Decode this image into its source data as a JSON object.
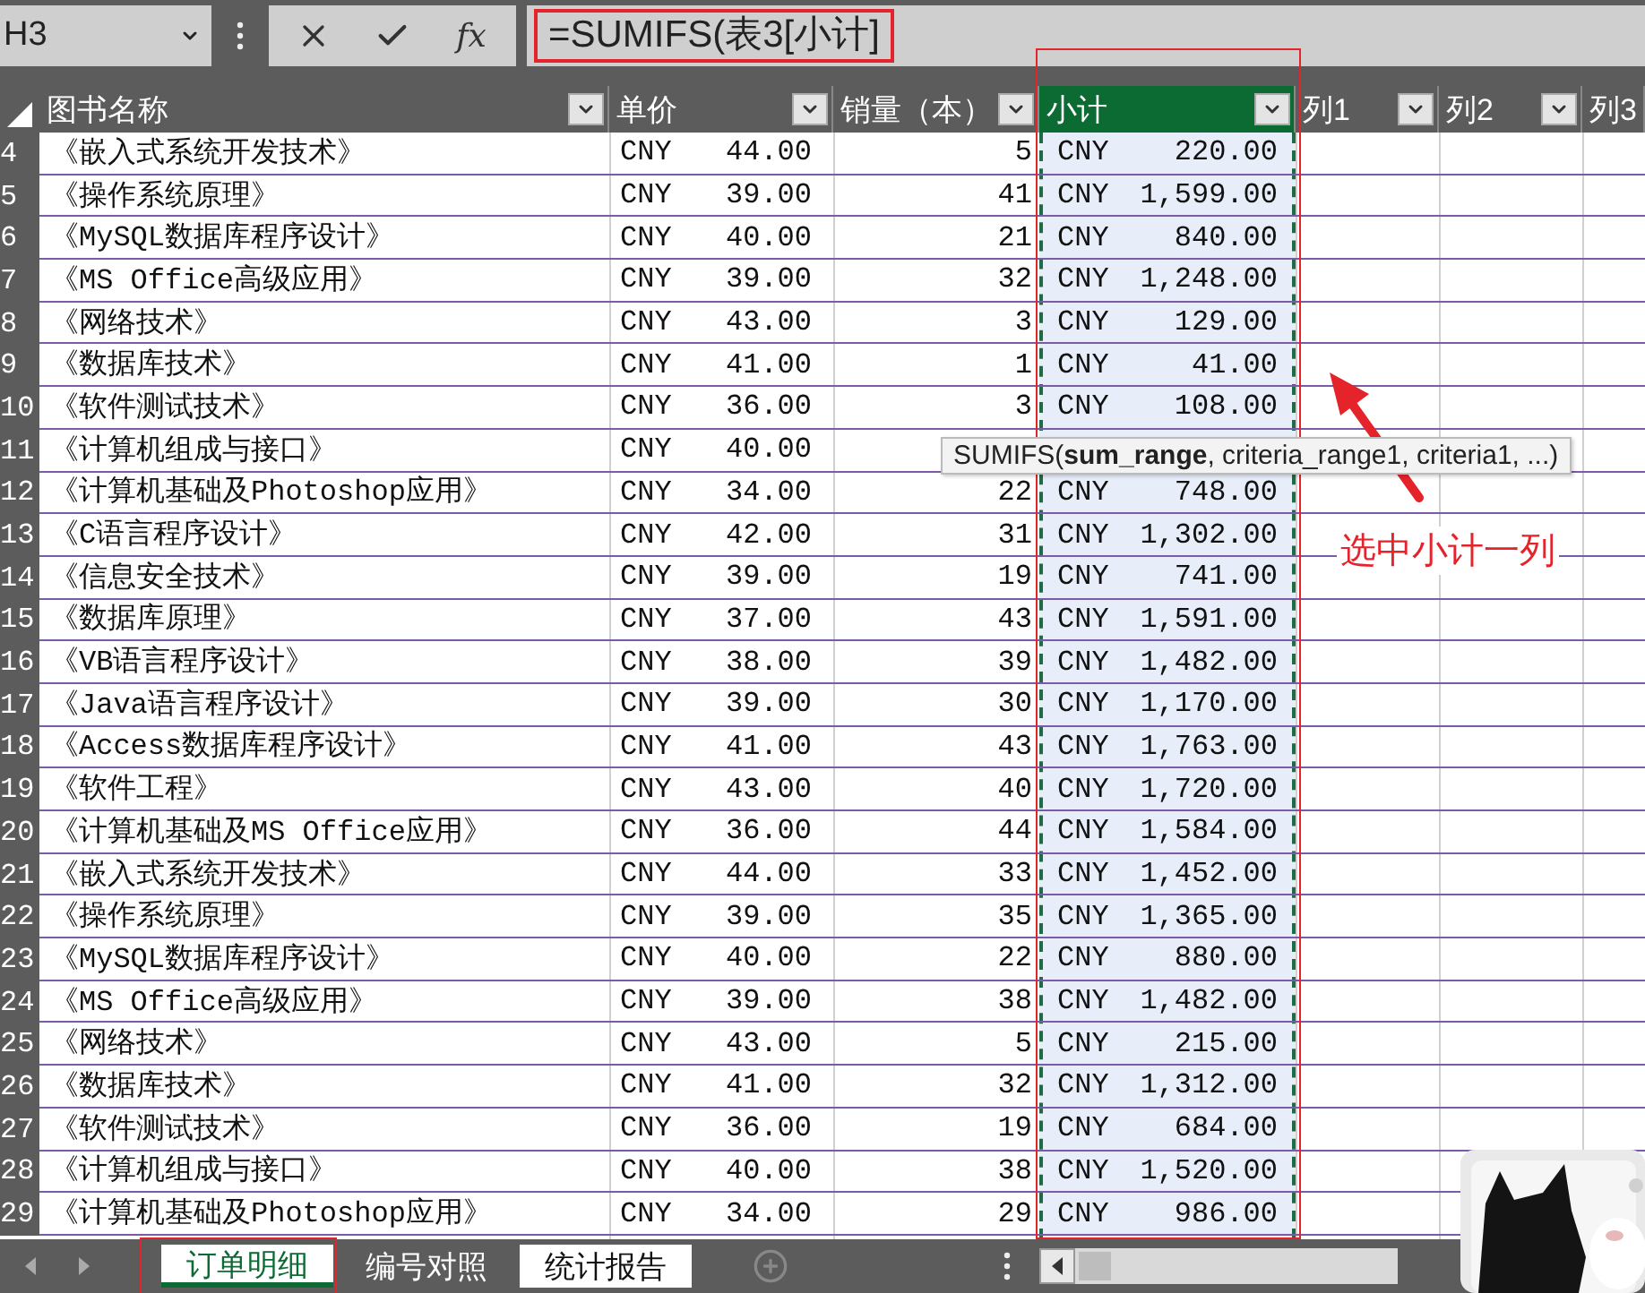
{
  "name_box": {
    "value": "H3"
  },
  "formula_bar": {
    "buttons": [
      {
        "kind": "cancel"
      },
      {
        "kind": "enter"
      },
      {
        "kind": "function",
        "label": "fx"
      }
    ],
    "formula": "=SUMIFS(表3[小计]"
  },
  "columns": [
    {
      "label": "图书名称",
      "selected": false,
      "filter": true
    },
    {
      "label": "单价",
      "selected": false,
      "filter": true
    },
    {
      "label": "销量（本）",
      "selected": false,
      "filter": true
    },
    {
      "label": "小计",
      "selected": true,
      "filter": true
    },
    {
      "label": "列1",
      "selected": false,
      "filter": true
    },
    {
      "label": "列2",
      "selected": false,
      "filter": true
    },
    {
      "label": "列3",
      "selected": false,
      "filter": false
    }
  ],
  "rows": [
    {
      "row": "4",
      "title": "《嵌入式系统开发技术》",
      "price": {
        "currency": "CNY",
        "amount": "44.00"
      },
      "quantity": "5",
      "subtotal": {
        "currency": "CNY",
        "amount": "220.00"
      }
    },
    {
      "row": "5",
      "title": "《操作系统原理》",
      "price": {
        "currency": "CNY",
        "amount": "39.00"
      },
      "quantity": "41",
      "subtotal": {
        "currency": "CNY",
        "amount": "1,599.00"
      }
    },
    {
      "row": "6",
      "title": "《MySQL数据库程序设计》",
      "price": {
        "currency": "CNY",
        "amount": "40.00"
      },
      "quantity": "21",
      "subtotal": {
        "currency": "CNY",
        "amount": "840.00"
      }
    },
    {
      "row": "7",
      "title": "《MS Office高级应用》",
      "price": {
        "currency": "CNY",
        "amount": "39.00"
      },
      "quantity": "32",
      "subtotal": {
        "currency": "CNY",
        "amount": "1,248.00"
      }
    },
    {
      "row": "8",
      "title": "《网络技术》",
      "price": {
        "currency": "CNY",
        "amount": "43.00"
      },
      "quantity": "3",
      "subtotal": {
        "currency": "CNY",
        "amount": "129.00"
      }
    },
    {
      "row": "9",
      "title": "《数据库技术》",
      "price": {
        "currency": "CNY",
        "amount": "41.00"
      },
      "quantity": "1",
      "subtotal": {
        "currency": "CNY",
        "amount": "41.00"
      }
    },
    {
      "row": "10",
      "title": "《软件测试技术》",
      "price": {
        "currency": "CNY",
        "amount": "36.00"
      },
      "quantity": "3",
      "subtotal": {
        "currency": "CNY",
        "amount": "108.00"
      }
    },
    {
      "row": "11",
      "title": "《计算机组成与接口》",
      "price": {
        "currency": "CNY",
        "amount": "40.00"
      }
    },
    {
      "row": "12",
      "title": "《计算机基础及Photoshop应用》",
      "price": {
        "currency": "CNY",
        "amount": "34.00"
      },
      "quantity": "22",
      "subtotal": {
        "currency": "CNY",
        "amount": "748.00"
      }
    },
    {
      "row": "13",
      "title": "《C语言程序设计》",
      "price": {
        "currency": "CNY",
        "amount": "42.00"
      },
      "quantity": "31",
      "subtotal": {
        "currency": "CNY",
        "amount": "1,302.00"
      }
    },
    {
      "row": "14",
      "title": "《信息安全技术》",
      "price": {
        "currency": "CNY",
        "amount": "39.00"
      },
      "quantity": "19",
      "subtotal": {
        "currency": "CNY",
        "amount": "741.00"
      }
    },
    {
      "row": "15",
      "title": "《数据库原理》",
      "price": {
        "currency": "CNY",
        "amount": "37.00"
      },
      "quantity": "43",
      "subtotal": {
        "currency": "CNY",
        "amount": "1,591.00"
      }
    },
    {
      "row": "16",
      "title": "《VB语言程序设计》",
      "price": {
        "currency": "CNY",
        "amount": "38.00"
      },
      "quantity": "39",
      "subtotal": {
        "currency": "CNY",
        "amount": "1,482.00"
      }
    },
    {
      "row": "17",
      "title": "《Java语言程序设计》",
      "price": {
        "currency": "CNY",
        "amount": "39.00"
      },
      "quantity": "30",
      "subtotal": {
        "currency": "CNY",
        "amount": "1,170.00"
      }
    },
    {
      "row": "18",
      "title": "《Access数据库程序设计》",
      "price": {
        "currency": "CNY",
        "amount": "41.00"
      },
      "quantity": "43",
      "subtotal": {
        "currency": "CNY",
        "amount": "1,763.00"
      }
    },
    {
      "row": "19",
      "title": "《软件工程》",
      "price": {
        "currency": "CNY",
        "amount": "43.00"
      },
      "quantity": "40",
      "subtotal": {
        "currency": "CNY",
        "amount": "1,720.00"
      }
    },
    {
      "row": "20",
      "title": "《计算机基础及MS Office应用》",
      "price": {
        "currency": "CNY",
        "amount": "36.00"
      },
      "quantity": "44",
      "subtotal": {
        "currency": "CNY",
        "amount": "1,584.00"
      }
    },
    {
      "row": "21",
      "title": "《嵌入式系统开发技术》",
      "price": {
        "currency": "CNY",
        "amount": "44.00"
      },
      "quantity": "33",
      "subtotal": {
        "currency": "CNY",
        "amount": "1,452.00"
      }
    },
    {
      "row": "22",
      "title": "《操作系统原理》",
      "price": {
        "currency": "CNY",
        "amount": "39.00"
      },
      "quantity": "35",
      "subtotal": {
        "currency": "CNY",
        "amount": "1,365.00"
      }
    },
    {
      "row": "23",
      "title": "《MySQL数据库程序设计》",
      "price": {
        "currency": "CNY",
        "amount": "40.00"
      },
      "quantity": "22",
      "subtotal": {
        "currency": "CNY",
        "amount": "880.00"
      }
    },
    {
      "row": "24",
      "title": "《MS Office高级应用》",
      "price": {
        "currency": "CNY",
        "amount": "39.00"
      },
      "quantity": "38",
      "subtotal": {
        "currency": "CNY",
        "amount": "1,482.00"
      }
    },
    {
      "row": "25",
      "title": "《网络技术》",
      "price": {
        "currency": "CNY",
        "amount": "43.00"
      },
      "quantity": "5",
      "subtotal": {
        "currency": "CNY",
        "amount": "215.00"
      }
    },
    {
      "row": "26",
      "title": "《数据库技术》",
      "price": {
        "currency": "CNY",
        "amount": "41.00"
      },
      "quantity": "32",
      "subtotal": {
        "currency": "CNY",
        "amount": "1,312.00"
      }
    },
    {
      "row": "27",
      "title": "《软件测试技术》",
      "price": {
        "currency": "CNY",
        "amount": "36.00"
      },
      "quantity": "19",
      "subtotal": {
        "currency": "CNY",
        "amount": "684.00"
      }
    },
    {
      "row": "28",
      "title": "《计算机组成与接口》",
      "price": {
        "currency": "CNY",
        "amount": "40.00"
      },
      "quantity": "38",
      "subtotal": {
        "currency": "CNY",
        "amount": "1,520.00"
      }
    },
    {
      "row": "29",
      "title": "《计算机基础及Photoshop应用》",
      "price": {
        "currency": "CNY",
        "amount": "34.00"
      },
      "quantity": "29",
      "subtotal": {
        "currency": "CNY",
        "amount": "986.00"
      }
    }
  ],
  "tooltip": {
    "text": "SUMIFS(**sum_range**, criteria_range1, criteria1, ...)"
  },
  "annotation": {
    "label": "选中小计一列"
  },
  "sheet_tabs": [
    {
      "label": "订单明细",
      "selected": true,
      "color": "#ffffff"
    },
    {
      "label": "编号对照",
      "selected": false,
      "color": "#5c5c5c"
    },
    {
      "label": "统计报告",
      "selected": false,
      "color": "#ffffff"
    }
  ]
}
